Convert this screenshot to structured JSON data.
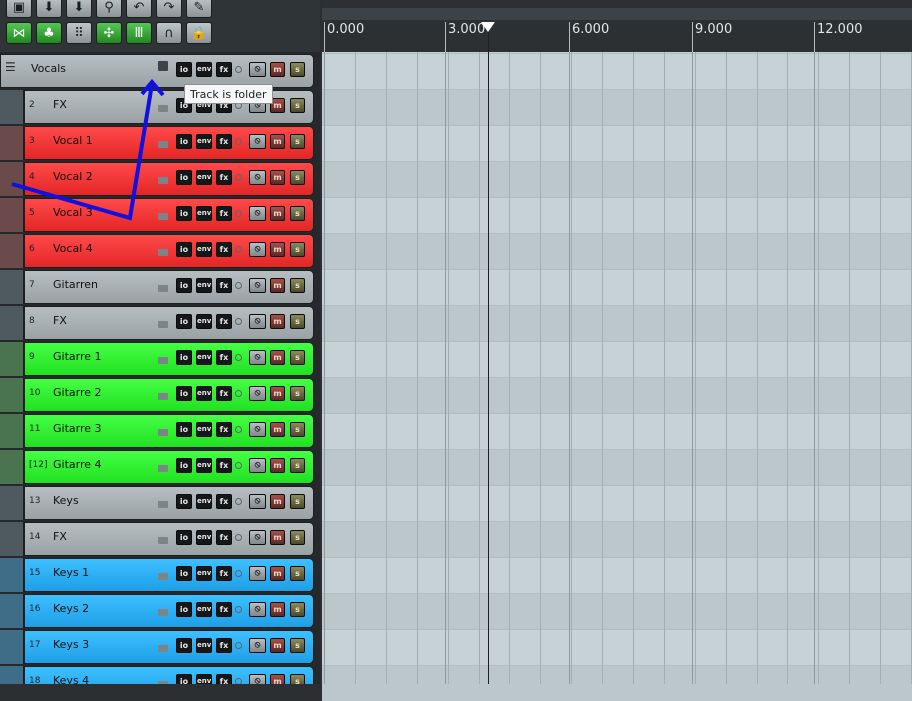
{
  "toolbar": {
    "row1": [
      {
        "name": "save-icon",
        "glyph": "▣"
      },
      {
        "name": "import-icon",
        "glyph": "⬇"
      },
      {
        "name": "render-icon",
        "glyph": "⬇"
      },
      {
        "name": "properties-icon",
        "glyph": "⚲"
      },
      {
        "name": "undo-icon",
        "glyph": "↶"
      },
      {
        "name": "redo-icon",
        "glyph": "↷"
      },
      {
        "name": "edit-icon",
        "glyph": "✎"
      }
    ],
    "row2": [
      {
        "name": "metronome-icon",
        "glyph": "⋈",
        "green": true
      },
      {
        "name": "clover-icon",
        "glyph": "♣",
        "green": true
      },
      {
        "name": "grid-icon",
        "glyph": "⠿",
        "green": false
      },
      {
        "name": "ripple-icon",
        "glyph": "✣",
        "green": true
      },
      {
        "name": "item-lock-icon",
        "glyph": "Ⅲ",
        "green": true
      },
      {
        "name": "magnet-icon",
        "glyph": "∩",
        "green": false
      },
      {
        "name": "lock-icon",
        "glyph": "🔒",
        "green": false
      }
    ]
  },
  "buttons": {
    "io": "io",
    "env": "env",
    "fx": "fx",
    "mute": "m",
    "solo": "s",
    "phase": "⦸"
  },
  "tooltip": "Track is folder",
  "colors": {
    "red": "#f03333",
    "green": "#33ee33",
    "blue": "#2aaef2",
    "gray": "#a9b0b3"
  },
  "tracks": [
    {
      "num": "",
      "name": "Vocals",
      "color": "gray",
      "folder": true
    },
    {
      "num": "2",
      "name": "FX",
      "color": "gray"
    },
    {
      "num": "3",
      "name": "Vocal 1",
      "color": "red"
    },
    {
      "num": "4",
      "name": "Vocal 2",
      "color": "red"
    },
    {
      "num": "5",
      "name": "Vocal 3",
      "color": "red"
    },
    {
      "num": "6",
      "name": "Vocal 4",
      "color": "red"
    },
    {
      "num": "7",
      "name": "Gitarren",
      "color": "gray"
    },
    {
      "num": "8",
      "name": "FX",
      "color": "gray"
    },
    {
      "num": "9",
      "name": "Gitarre 1",
      "color": "green"
    },
    {
      "num": "10",
      "name": "Gitarre 2",
      "color": "green"
    },
    {
      "num": "11",
      "name": "Gitarre 3",
      "color": "green"
    },
    {
      "num": "[12]",
      "name": "Gitarre 4",
      "color": "green"
    },
    {
      "num": "13",
      "name": "Keys",
      "color": "gray"
    },
    {
      "num": "14",
      "name": "FX",
      "color": "gray"
    },
    {
      "num": "15",
      "name": "Keys 1",
      "color": "blue"
    },
    {
      "num": "16",
      "name": "Keys 2",
      "color": "blue"
    },
    {
      "num": "17",
      "name": "Keys 3",
      "color": "blue"
    },
    {
      "num": "18",
      "name": "Keys 4",
      "color": "blue"
    }
  ],
  "ruler": {
    "labels": [
      "0.000",
      "3.000",
      "6.000",
      "9.000",
      "12.000"
    ]
  }
}
